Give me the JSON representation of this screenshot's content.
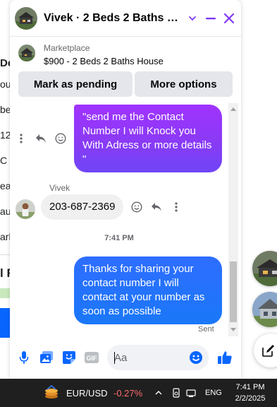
{
  "background_page": {
    "snippets": [
      "De",
      "ou",
      "be",
      "12",
      "C a",
      "ea",
      "au",
      "ark",
      "l R"
    ]
  },
  "chat": {
    "title": "Vivek · 2 Beds 2 Baths Hou...",
    "listing": {
      "source": "Marketplace",
      "title": "$900 - 2 Beds 2 Baths House"
    },
    "actions": {
      "mark_pending": "Mark as pending",
      "more_options": "More options"
    },
    "messages": [
      {
        "direction": "sent",
        "lines": [
          "\"send me the Contact",
          "Number I will Knock you",
          "With Adress or more details",
          "\""
        ]
      },
      {
        "direction": "received",
        "sender": "Vivek",
        "text": "203-687-2369"
      },
      {
        "direction": "divider",
        "text": "7:41 PM"
      },
      {
        "direction": "sent",
        "lines": [
          "Thanks for sharing your",
          "contact number I will",
          "contact at your number as",
          "soon as possible"
        ],
        "status": "Sent"
      }
    ],
    "composer": {
      "placeholder": "Aa",
      "icons": [
        "microphone-icon",
        "photo-icon",
        "sticker-icon",
        "gif-icon",
        "emoji-icon",
        "like-icon"
      ]
    }
  },
  "taskbar": {
    "ticker_pair": "EUR/USD",
    "ticker_change": "-0.27%",
    "language": "ENG",
    "time": "7:41 PM",
    "date": "2/2/2025"
  },
  "colors": {
    "accent": "#7f38f6",
    "sent_bubble_purple": "#9b36fb",
    "sent_bubble_blue": "#1f70ff",
    "messenger_blue": "#0866ff",
    "ticker_negative": "#ff6b6b"
  }
}
